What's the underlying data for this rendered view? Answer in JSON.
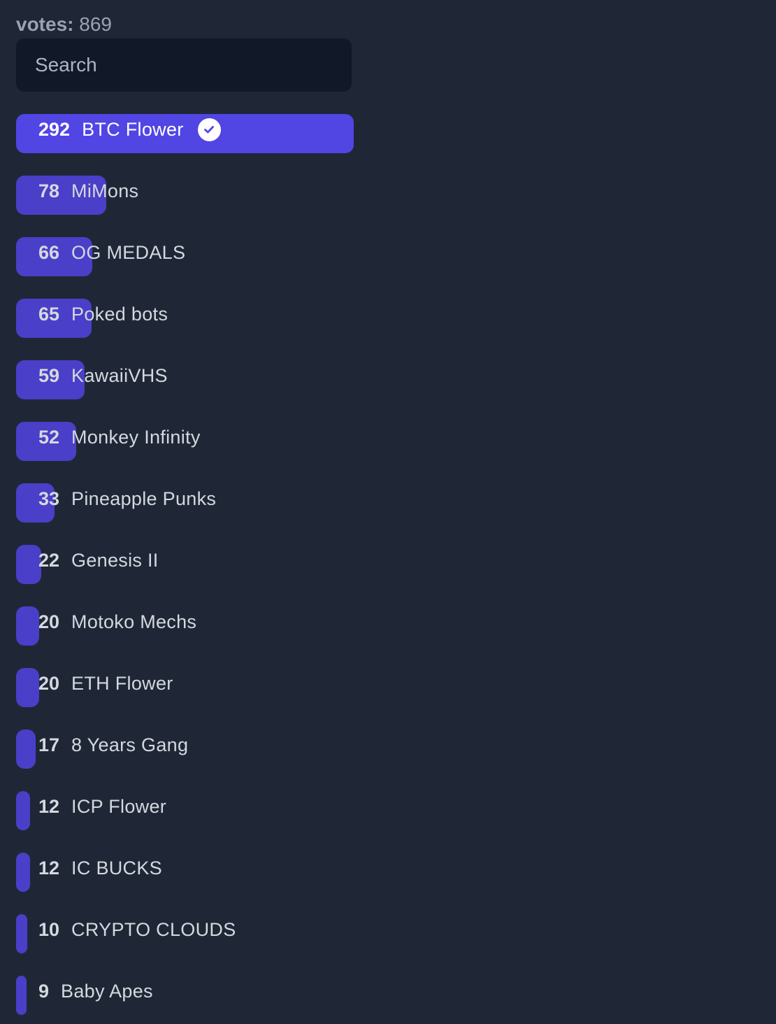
{
  "votes": {
    "label": "votes:",
    "value": "869"
  },
  "search": {
    "placeholder": "Search",
    "value": ""
  },
  "items": [
    {
      "count": "292",
      "name": "BTC Flower",
      "share": 1.0,
      "selected": true
    },
    {
      "count": "78",
      "name": "MiMons",
      "share": 0.267,
      "selected": false
    },
    {
      "count": "66",
      "name": "OG MEDALS",
      "share": 0.226,
      "selected": false
    },
    {
      "count": "65",
      "name": "Poked bots",
      "share": 0.223,
      "selected": false
    },
    {
      "count": "59",
      "name": "KawaiiVHS",
      "share": 0.202,
      "selected": false
    },
    {
      "count": "52",
      "name": "Monkey Infinity",
      "share": 0.178,
      "selected": false
    },
    {
      "count": "33",
      "name": "Pineapple Punks",
      "share": 0.113,
      "selected": false
    },
    {
      "count": "22",
      "name": "Genesis II",
      "share": 0.075,
      "selected": false
    },
    {
      "count": "20",
      "name": "Motoko Mechs",
      "share": 0.068,
      "selected": false
    },
    {
      "count": "20",
      "name": "ETH Flower",
      "share": 0.068,
      "selected": false
    },
    {
      "count": "17",
      "name": "8 Years Gang",
      "share": 0.058,
      "selected": false
    },
    {
      "count": "12",
      "name": "ICP Flower",
      "share": 0.041,
      "selected": false
    },
    {
      "count": "12",
      "name": "IC BUCKS",
      "share": 0.041,
      "selected": false
    },
    {
      "count": "10",
      "name": "CRYPTO CLOUDS",
      "share": 0.034,
      "selected": false
    },
    {
      "count": "9",
      "name": "Baby Apes",
      "share": 0.031,
      "selected": false
    }
  ],
  "colors": {
    "background": "#1f2737",
    "search_bg": "#111827",
    "bar": "#4a3fc8",
    "bar_selected": "#5145e4"
  },
  "icons": {
    "selected": "check-circle-icon"
  }
}
